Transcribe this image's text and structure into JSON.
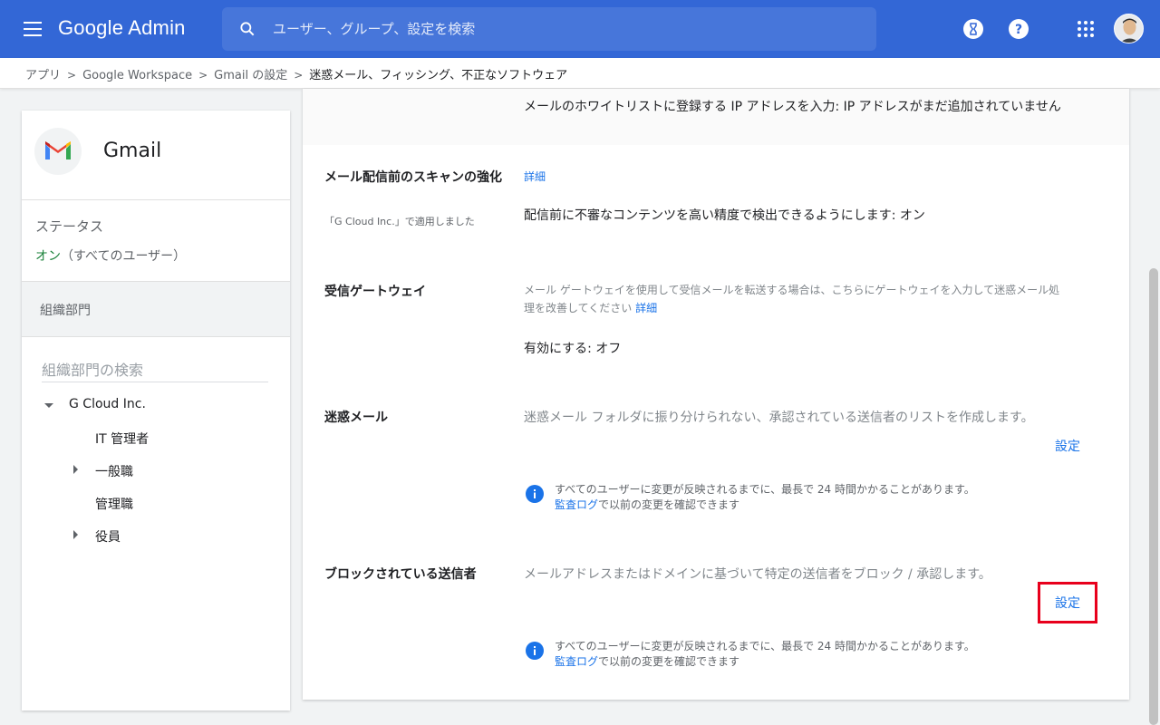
{
  "header": {
    "logo": "Google Admin",
    "search_placeholder": "ユーザー、グループ、設定を検索"
  },
  "breadcrumb": {
    "items": [
      "アプリ",
      "Google Workspace",
      "Gmail の設定"
    ],
    "current": "迷惑メール、フィッシング、不正なソフトウェア"
  },
  "sidebar": {
    "app_name": "Gmail",
    "status_label": "ステータス",
    "status_on": "オン",
    "status_scope": "（すべてのユーザー）",
    "org_header": "組織部門",
    "org_search_placeholder": "組織部門の検索",
    "tree": [
      {
        "label": "G Cloud Inc.",
        "expander": "down"
      },
      {
        "label": "IT 管理者",
        "expander": "none"
      },
      {
        "label": "一般職",
        "expander": "right"
      },
      {
        "label": "管理職",
        "expander": "none"
      },
      {
        "label": "役員",
        "expander": "right"
      }
    ]
  },
  "main": {
    "whitelist_text": "メールのホワイトリストに登録する IP アドレスを入力: IP アドレスがまだ追加されていません",
    "scan": {
      "title": "メール配信前のスキャンの強化",
      "subtitle": "「G Cloud Inc.」で適用しました",
      "link": "詳細",
      "value": "配信前に不審なコンテンツを高い精度で検出できるようにします: オン"
    },
    "gateway": {
      "title": "受信ゲートウェイ",
      "desc_line1": "メール ゲートウェイを使用して受信メールを転送する場合は、こちらにゲートウェイを入力して迷惑メール処",
      "desc_line2": "理を改善してください",
      "link": "詳細",
      "value": "有効にする: オフ"
    },
    "spam": {
      "title": "迷惑メール",
      "desc": "迷惑メール フォルダに振り分けられない、承認されている送信者のリストを作成します。",
      "button": "設定",
      "info_line1": "すべてのユーザーに変更が反映されるまでに、最長で 24 時間かかることがあります。",
      "info_link": "監査ログ",
      "info_line2": "で以前の変更を確認できます"
    },
    "blocked": {
      "title": "ブロックされている送信者",
      "desc": "メールアドレスまたはドメインに基づいて特定の送信者をブロック / 承認します。",
      "button": "設定",
      "info_line1": "すべてのユーザーに変更が反映されるまでに、最長で 24 時間かかることがあります。",
      "info_link": "監査ログ",
      "info_line2": "で以前の変更を確認できます"
    }
  },
  "icons": [
    "menu-icon",
    "search-icon",
    "hourglass-icon",
    "help-icon",
    "apps-grid-icon",
    "avatar",
    "gmail-logo-icon",
    "info-icon"
  ],
  "colors": {
    "topbar": "#3367d6",
    "link": "#1a73e8",
    "status_on": "#188038",
    "highlight": "#e8001c"
  }
}
